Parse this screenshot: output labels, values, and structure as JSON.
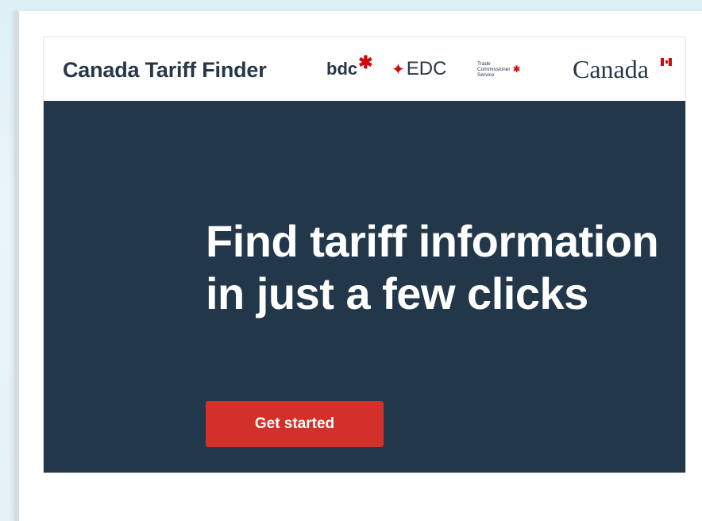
{
  "header": {
    "site_title": "Canada Tariff Finder",
    "partners": {
      "bdc": "bdc",
      "edc": "EDC",
      "tcs_lines": [
        "Trade",
        "Commissioner",
        "Service"
      ],
      "canada": "Canada"
    }
  },
  "hero": {
    "title": "Find tariff information in just a few clicks",
    "cta_label": "Get started"
  },
  "colors": {
    "navy": "#23374b",
    "accent_red": "#d3302b",
    "title_text": "#26374a"
  },
  "icons": {
    "bdc_star": "asterisk-star-icon",
    "edc_leaf": "maple-leaf-icon",
    "tcs_leaf": "maple-leaf-icon",
    "canada_flag": "canada-flag-icon"
  }
}
